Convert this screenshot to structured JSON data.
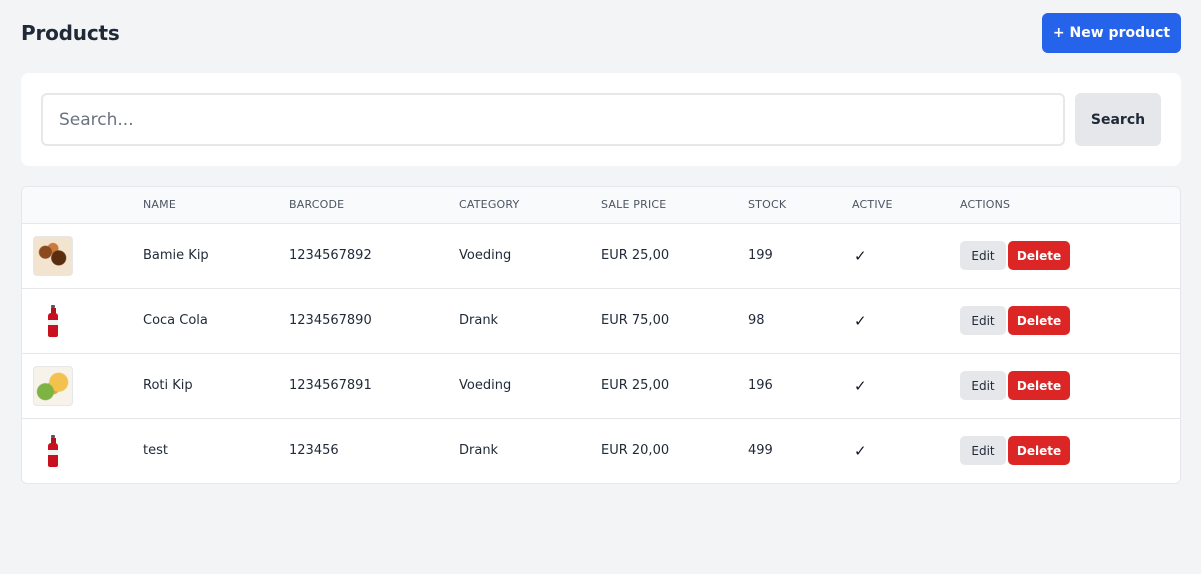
{
  "header": {
    "title": "Products",
    "new_button_label": "+ New product"
  },
  "search": {
    "placeholder": "Search...",
    "value": "",
    "button_label": "Search"
  },
  "table": {
    "columns": [
      "",
      "NAME",
      "BARCODE",
      "CATEGORY",
      "SALE PRICE",
      "STOCK",
      "ACTIVE",
      "ACTIONS"
    ],
    "rows": [
      {
        "image": "bamie-kip-photo",
        "name": "Bamie Kip",
        "barcode": "1234567892",
        "category": "Voeding",
        "sale_price": "EUR 25,00",
        "stock": "199",
        "active": "✓"
      },
      {
        "image": "coca-cola-bottle-photo",
        "name": "Coca Cola",
        "barcode": "1234567890",
        "category": "Drank",
        "sale_price": "EUR 75,00",
        "stock": "98",
        "active": "✓"
      },
      {
        "image": "roti-kip-photo",
        "name": "Roti Kip",
        "barcode": "1234567891",
        "category": "Voeding",
        "sale_price": "EUR 25,00",
        "stock": "196",
        "active": "✓"
      },
      {
        "image": "coca-cola-bottle-photo",
        "name": "test",
        "barcode": "123456",
        "category": "Drank",
        "sale_price": "EUR 20,00",
        "stock": "499",
        "active": "✓"
      }
    ],
    "edit_label": "Edit",
    "delete_label": "Delete"
  },
  "colors": {
    "primary": "#2563eb",
    "danger": "#dc2626",
    "background": "#f3f4f6"
  }
}
